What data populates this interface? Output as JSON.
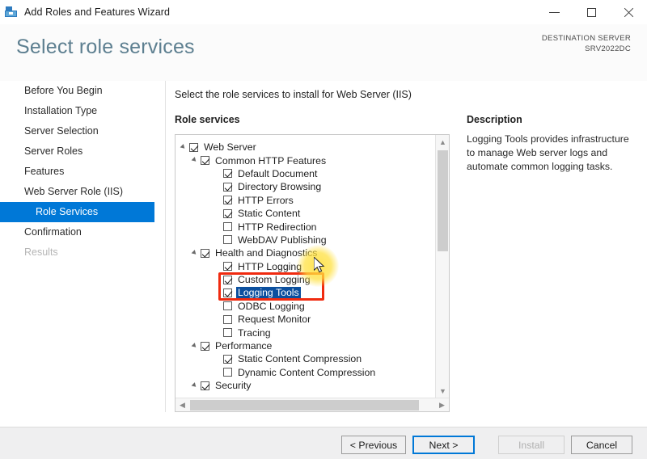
{
  "window": {
    "title": "Add Roles and Features Wizard",
    "icon": "server-wizard-icon",
    "controls": {
      "minimize": "minimize-icon",
      "maximize": "maximize-icon",
      "close": "close-icon"
    }
  },
  "header": {
    "page_title": "Select role services",
    "destination_label": "DESTINATION SERVER",
    "destination_server": "SRV2022DC",
    "title_color": "#5d7f90"
  },
  "sidebar": {
    "items": [
      {
        "label": "Before You Begin",
        "state": "normal",
        "level": 0
      },
      {
        "label": "Installation Type",
        "state": "normal",
        "level": 0
      },
      {
        "label": "Server Selection",
        "state": "normal",
        "level": 0
      },
      {
        "label": "Server Roles",
        "state": "normal",
        "level": 0
      },
      {
        "label": "Features",
        "state": "normal",
        "level": 0
      },
      {
        "label": "Web Server Role (IIS)",
        "state": "normal",
        "level": 0
      },
      {
        "label": "Role Services",
        "state": "selected",
        "level": 1
      },
      {
        "label": "Confirmation",
        "state": "normal",
        "level": 0
      },
      {
        "label": "Results",
        "state": "disabled",
        "level": 0
      }
    ],
    "selected_color": "#0078d7"
  },
  "main": {
    "intro_text": "Select the role services to install for Web Server (IIS)",
    "role_services_label": "Role services",
    "tree": [
      {
        "label": "Web Server",
        "level": 0,
        "checked": true,
        "expander": true,
        "selected": false
      },
      {
        "label": "Common HTTP Features",
        "level": 1,
        "checked": true,
        "expander": true,
        "selected": false
      },
      {
        "label": "Default Document",
        "level": 2,
        "checked": true,
        "expander": false,
        "selected": false
      },
      {
        "label": "Directory Browsing",
        "level": 2,
        "checked": true,
        "expander": false,
        "selected": false
      },
      {
        "label": "HTTP Errors",
        "level": 2,
        "checked": true,
        "expander": false,
        "selected": false
      },
      {
        "label": "Static Content",
        "level": 2,
        "checked": true,
        "expander": false,
        "selected": false
      },
      {
        "label": "HTTP Redirection",
        "level": 2,
        "checked": false,
        "expander": false,
        "selected": false
      },
      {
        "label": "WebDAV Publishing",
        "level": 2,
        "checked": false,
        "expander": false,
        "selected": false
      },
      {
        "label": "Health and Diagnostics",
        "level": 1,
        "checked": true,
        "expander": true,
        "selected": false
      },
      {
        "label": "HTTP Logging",
        "level": 2,
        "checked": true,
        "expander": false,
        "selected": false
      },
      {
        "label": "Custom Logging",
        "level": 2,
        "checked": true,
        "expander": false,
        "selected": false
      },
      {
        "label": "Logging Tools",
        "level": 2,
        "checked": true,
        "expander": false,
        "selected": true
      },
      {
        "label": "ODBC Logging",
        "level": 2,
        "checked": false,
        "expander": false,
        "selected": false
      },
      {
        "label": "Request Monitor",
        "level": 2,
        "checked": false,
        "expander": false,
        "selected": false
      },
      {
        "label": "Tracing",
        "level": 2,
        "checked": false,
        "expander": false,
        "selected": false
      },
      {
        "label": "Performance",
        "level": 1,
        "checked": true,
        "expander": true,
        "selected": false
      },
      {
        "label": "Static Content Compression",
        "level": 2,
        "checked": true,
        "expander": false,
        "selected": false
      },
      {
        "label": "Dynamic Content Compression",
        "level": 2,
        "checked": false,
        "expander": false,
        "selected": false
      },
      {
        "label": "Security",
        "level": 1,
        "checked": true,
        "expander": true,
        "selected": false
      }
    ],
    "scrollbars": {
      "v_up": "chevron-up-icon",
      "v_down": "chevron-down-icon",
      "h_left": "chevron-left-icon",
      "h_right": "chevron-right-icon"
    }
  },
  "description": {
    "title": "Description",
    "text": "Logging Tools provides infrastructure to manage Web server logs and automate common logging tasks."
  },
  "footer": {
    "previous": "< Previous",
    "next": "Next >",
    "install": "Install",
    "cancel": "Cancel",
    "focus_color": "#0078d7"
  },
  "annotation": {
    "highlight_color": "#f02b10",
    "cursor_glow_color": "#ffe03c"
  }
}
